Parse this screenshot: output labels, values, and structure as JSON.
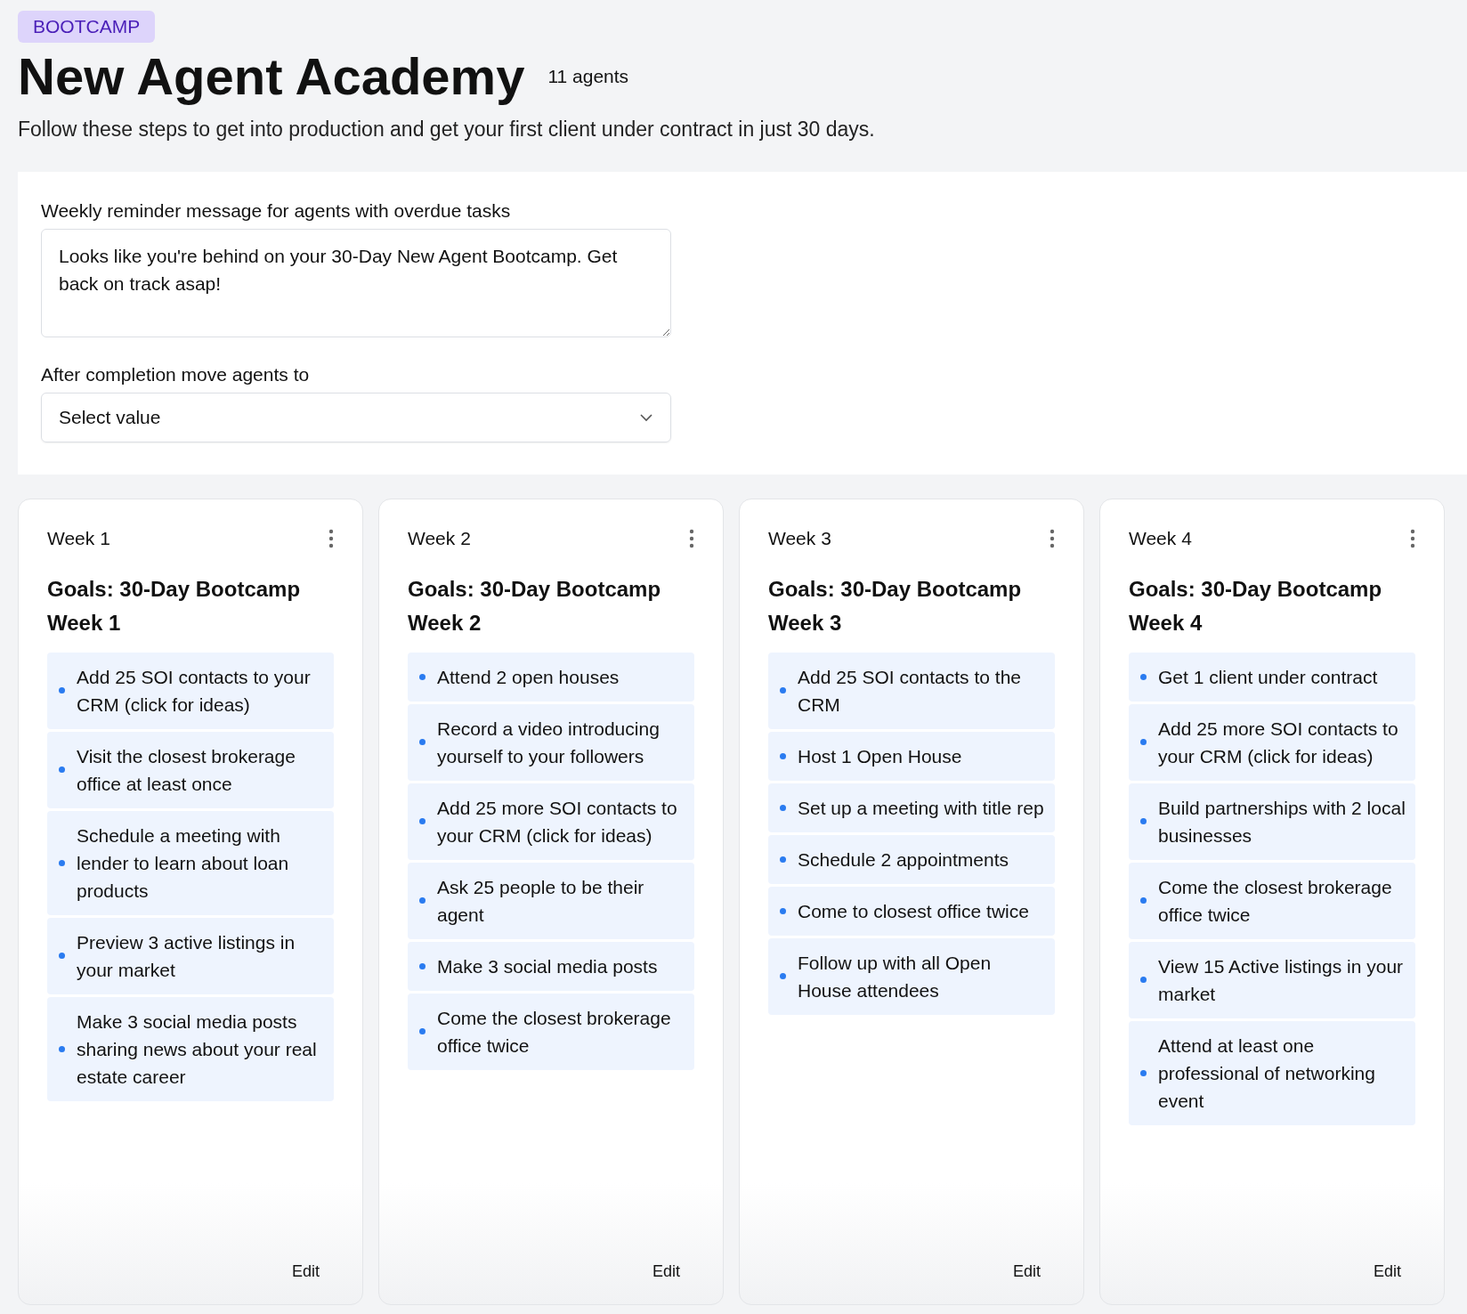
{
  "badge": "BOOTCAMP",
  "title": "New Agent Academy",
  "agent_count": "11 agents",
  "description": "Follow these steps to get into production and get your first client under contract in just 30 days.",
  "reminder": {
    "label": "Weekly reminder message for agents with overdue tasks",
    "value": "Looks like you're behind on your 30-Day New Agent Bootcamp. Get back on track asap!"
  },
  "completion": {
    "label": "After completion move agents to",
    "placeholder": "Select value"
  },
  "weeks": [
    {
      "label": "Week 1",
      "goal_title": "Goals: 30-Day Bootcamp Week 1",
      "tasks": [
        "Add 25 SOI contacts to your CRM (click for ideas)",
        "Visit the closest brokerage office at least once",
        "Schedule a meeting with lender to learn about loan products",
        "Preview 3 active listings in your market",
        "Make 3 social media posts sharing news about your real estate career"
      ],
      "edit": "Edit"
    },
    {
      "label": "Week 2",
      "goal_title": "Goals: 30-Day Bootcamp Week 2",
      "tasks": [
        "Attend 2 open houses",
        "Record a video introducing yourself to your followers",
        "Add 25 more SOI contacts to your CRM (click for ideas)",
        "Ask 25 people to be their agent",
        "Make 3 social media posts",
        "Come the closest brokerage office twice"
      ],
      "edit": "Edit"
    },
    {
      "label": "Week 3",
      "goal_title": "Goals: 30-Day Bootcamp Week 3",
      "tasks": [
        "Add 25 SOI contacts to the CRM",
        "Host 1 Open House",
        "Set up a meeting with title rep",
        "Schedule 2 appointments",
        "Come to closest office twice",
        "Follow up with all Open House attendees"
      ],
      "edit": "Edit"
    },
    {
      "label": "Week 4",
      "goal_title": "Goals: 30-Day Bootcamp Week 4",
      "tasks": [
        "Get 1 client under contract",
        "Add 25 more SOI contacts to your CRM (click for ideas)",
        "Build partnerships with 2 local businesses",
        "Come the closest brokerage office twice",
        "View 15 Active listings in your market",
        "Attend at least one professional of networking event"
      ],
      "edit": "Edit"
    }
  ]
}
